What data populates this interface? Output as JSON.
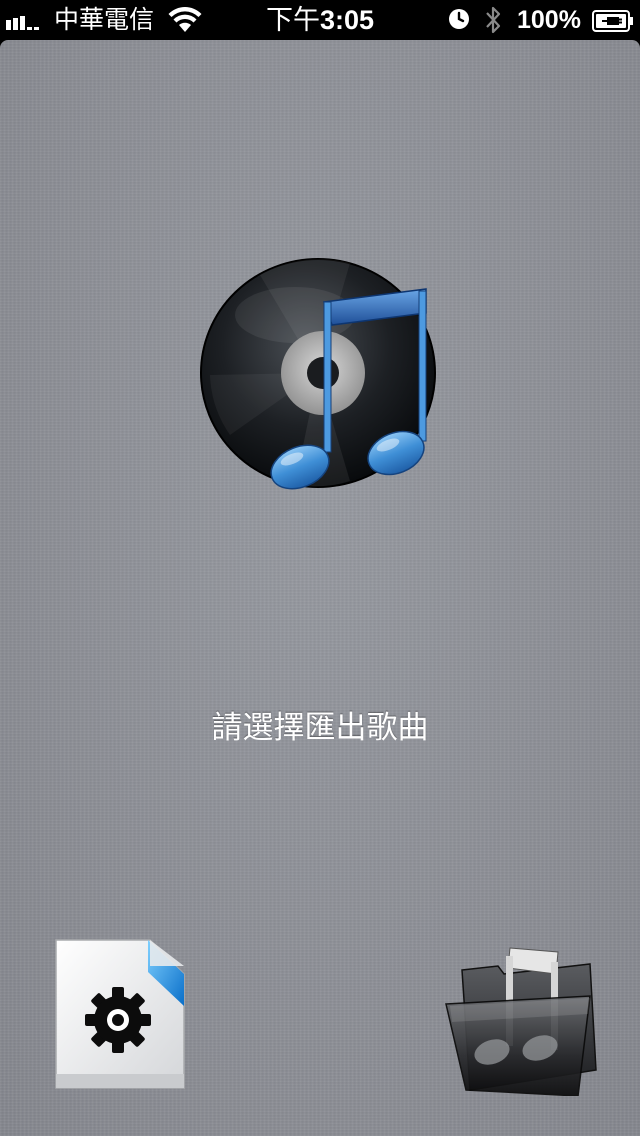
{
  "status_bar": {
    "carrier": "中華電信",
    "time_prefix": "下午",
    "time": "3:05",
    "battery_percent": "100%",
    "icons": [
      "signal-icon",
      "wifi-icon",
      "alarm-icon",
      "bluetooth-icon",
      "battery-charging-icon"
    ]
  },
  "main": {
    "logo_icon": "music-disc-icon",
    "prompt": "請選擇匯出歌曲"
  },
  "toolbar": {
    "left_icon": "settings-file-icon",
    "right_icon": "music-folder-icon"
  },
  "colors": {
    "background": "#8d8f96",
    "status_bar": "#000000",
    "note_blue": "#3f8fd6",
    "text": "#ffffff"
  }
}
